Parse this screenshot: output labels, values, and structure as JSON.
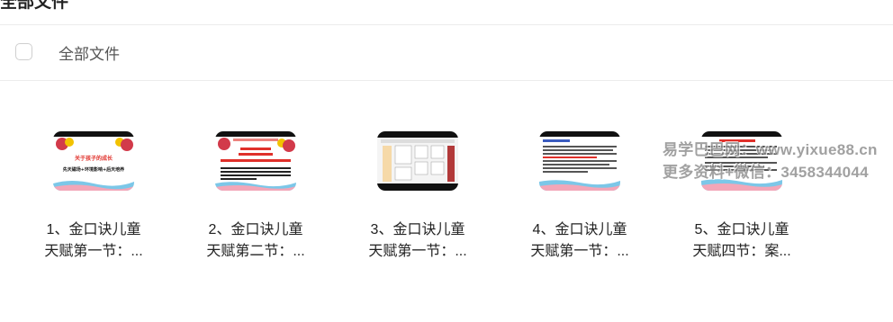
{
  "header": {
    "title": "全部文件"
  },
  "toolbar": {
    "select_all_label": "全部文件"
  },
  "files": [
    {
      "line1": "1、金口诀儿童",
      "line2": "天赋第一节：...",
      "thumb_title": "关于孩子的成长",
      "thumb_sub": "先天磁场+环境影响+后天培养"
    },
    {
      "line1": "2、金口诀儿童",
      "line2": "天赋第二节：..."
    },
    {
      "line1": "3、金口诀儿童",
      "line2": "天赋第一节：..."
    },
    {
      "line1": "4、金口诀儿童",
      "line2": "天赋第一节：..."
    },
    {
      "line1": "5、金口诀儿童",
      "line2": "天赋四节：案..."
    }
  ],
  "watermark": {
    "line1": "易学巴巴网：www.yixue88.cn",
    "line2": "更多资料+微信：3458344044"
  },
  "colors": {
    "accent_red": "#e0302a",
    "thumb_dark": "#111111",
    "balloon_yellow": "#f2c200"
  }
}
